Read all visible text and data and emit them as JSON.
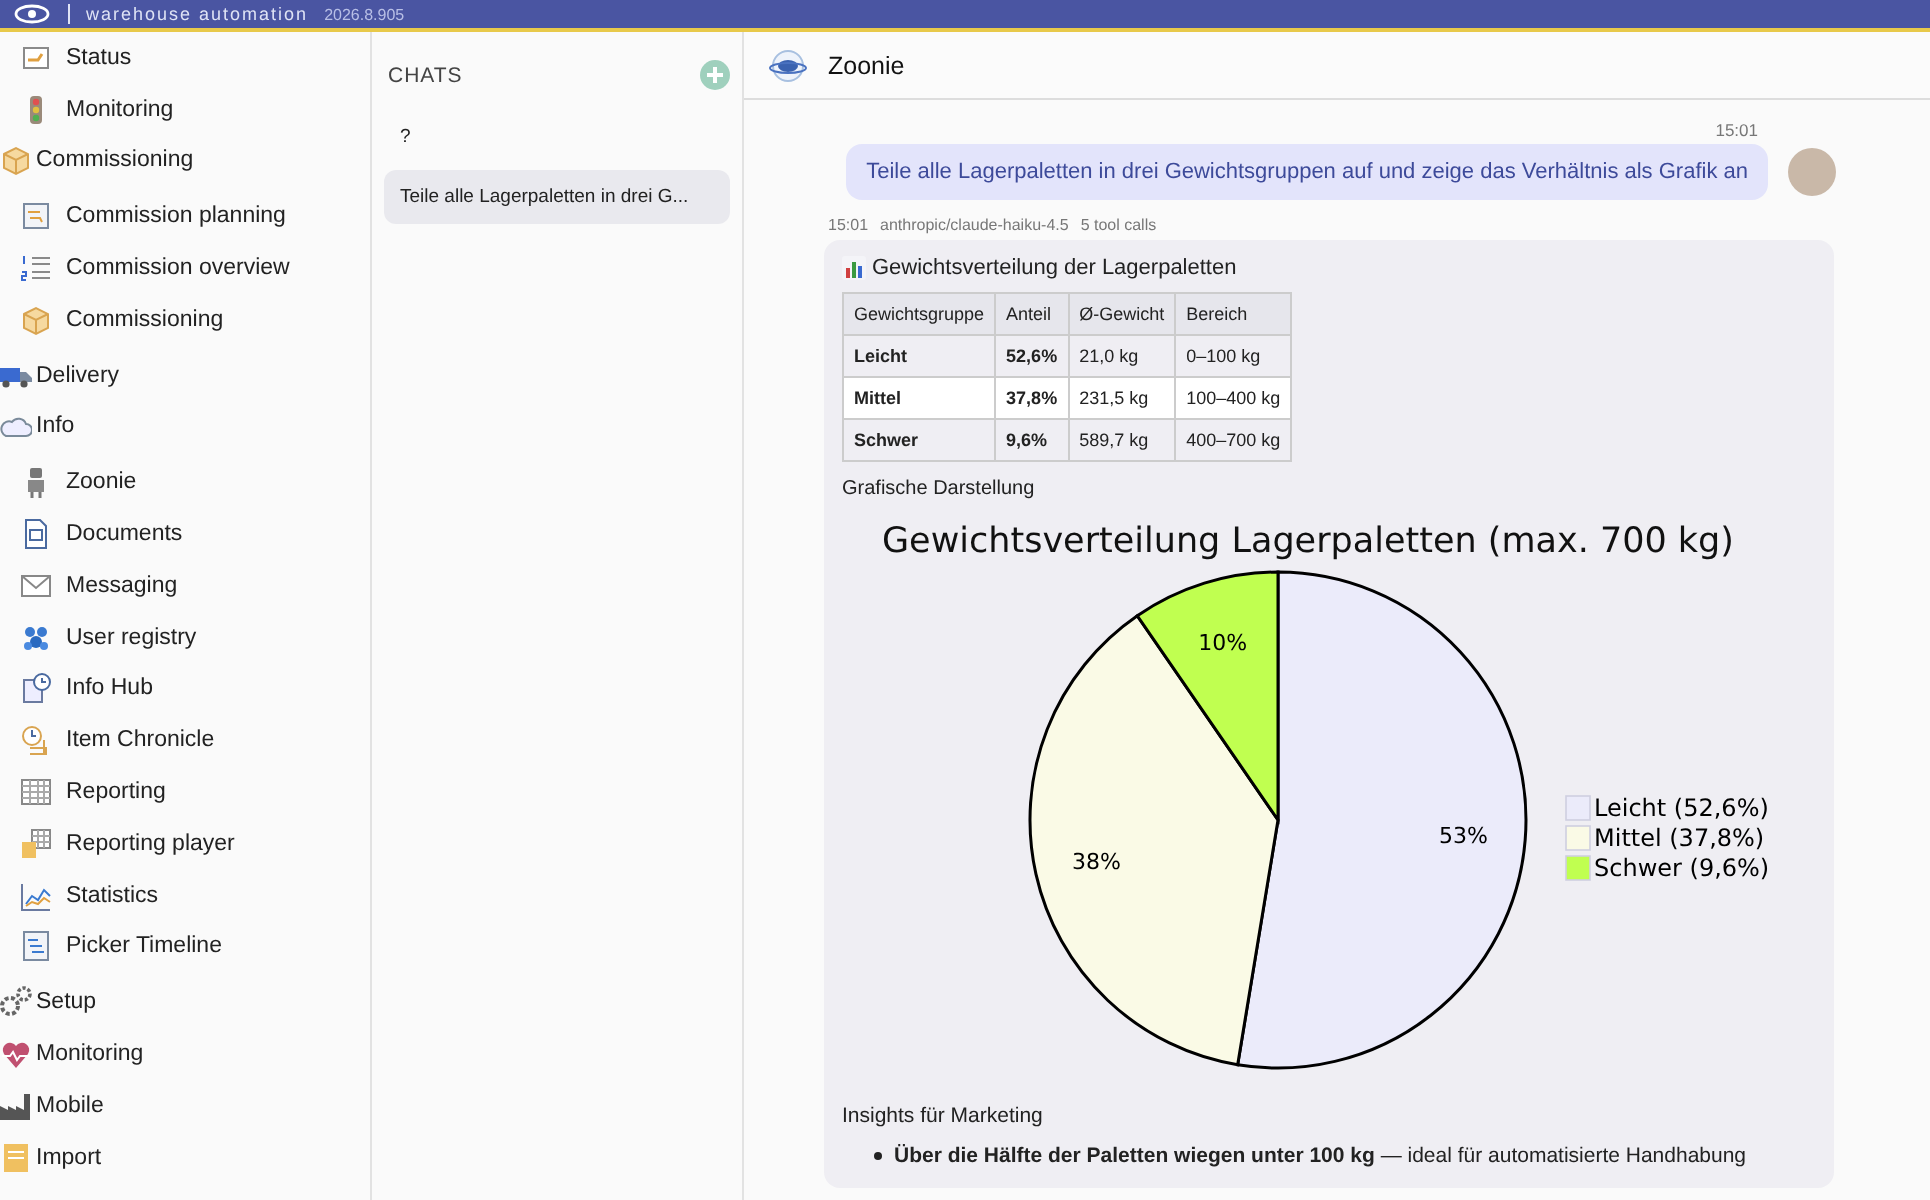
{
  "top_bar": {
    "product": "warehouse automation",
    "version": "2026.8.905"
  },
  "sidebar": {
    "continued_items": [
      {
        "label": "Status"
      },
      {
        "label": "Monitoring"
      }
    ],
    "groups": [
      {
        "label": "Commissioning",
        "children": [
          {
            "label": "Commission planning"
          },
          {
            "label": "Commission overview"
          },
          {
            "label": "Commissioning"
          }
        ]
      },
      {
        "label": "Delivery"
      },
      {
        "label": "Info",
        "children": [
          {
            "label": "Zoonie"
          },
          {
            "label": "Documents"
          },
          {
            "label": "Messaging"
          },
          {
            "label": "User registry"
          },
          {
            "label": "Info Hub"
          },
          {
            "label": "Item Chronicle"
          },
          {
            "label": "Reporting"
          },
          {
            "label": "Reporting player"
          },
          {
            "label": "Statistics"
          },
          {
            "label": "Picker Timeline"
          }
        ]
      },
      {
        "label": "Setup"
      },
      {
        "label": "Monitoring"
      },
      {
        "label": "Mobile"
      },
      {
        "label": "Import"
      }
    ]
  },
  "chats": {
    "title": "CHATS",
    "items": [
      {
        "label": "?",
        "selected": false
      },
      {
        "label": "Teile alle Lagerpaletten in drei G...",
        "selected": true
      }
    ]
  },
  "conversation": {
    "title": "Zoonie",
    "user_message": {
      "time": "15:01",
      "text": "Teile alle Lagerpaletten in drei Gewichtsgruppen auf und zeige das Verhältnis als Grafik an"
    },
    "reply": {
      "time": "15:01",
      "model": "anthropic/claude-haiku-4.5",
      "tool_calls": "5 tool calls",
      "heading": "Gewichtsverteilung der Lagerpaletten",
      "table": {
        "columns": [
          "Gewichtsgruppe",
          "Anteil",
          "Ø-Gewicht",
          "Bereich"
        ],
        "rows": [
          [
            "Leicht",
            "52,6%",
            "21,0 kg",
            "0–100 kg"
          ],
          [
            "Mittel",
            "37,8%",
            "231,5 kg",
            "100–400 kg"
          ],
          [
            "Schwer",
            "9,6%",
            "589,7 kg",
            "400–700 kg"
          ]
        ]
      },
      "chart_caption": "Grafische Darstellung",
      "chart_data": {
        "type": "pie",
        "title": "Gewichtsverteilung Lagerpaletten (max. 700 kg)",
        "categories": [
          "Leicht (52,6%)",
          "Mittel (37,8%)",
          "Schwer (9,6%)"
        ],
        "legend": true,
        "series": [
          {
            "colors": [
              "#ebebfa",
              "#fafae6",
              "#c0ff50"
            ],
            "values": [
              52.6,
              37.8,
              9.6
            ]
          }
        ],
        "value_labels": [
          "53%",
          "38%",
          "10%"
        ]
      },
      "insights_heading": "Insights für Marketing",
      "bullets": [
        "**Über die Hälfte der Paletten wiegen unter 100 kg** — ideal für automatisierte Handhabung"
      ]
    }
  }
}
